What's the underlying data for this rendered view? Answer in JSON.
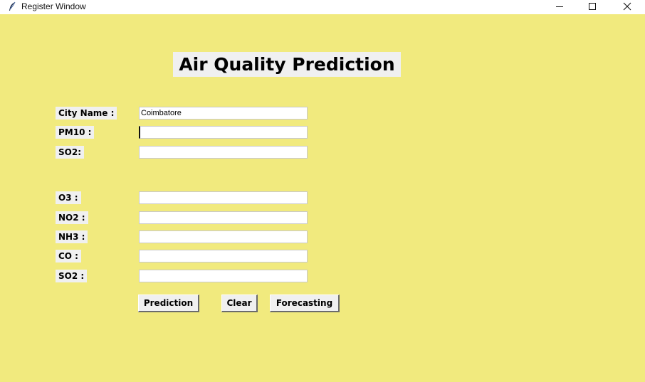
{
  "window": {
    "title": "Register Window",
    "icon": "feather-icon",
    "controls": [
      "minimize-icon",
      "maximize-icon",
      "close-icon"
    ]
  },
  "heading": "Air Quality Prediction",
  "form": {
    "fields": [
      {
        "label": "City Name :",
        "value": "Coimbatore"
      },
      {
        "label": "PM10 :",
        "value": ""
      },
      {
        "label": "SO2:",
        "value": ""
      },
      {
        "label": "O3 :",
        "value": ""
      },
      {
        "label": "NO2 :",
        "value": ""
      },
      {
        "label": "NH3 :",
        "value": ""
      },
      {
        "label": "CO :",
        "value": ""
      },
      {
        "label": "SO2 :",
        "value": ""
      }
    ]
  },
  "buttons": {
    "prediction": "Prediction",
    "clear": "Clear",
    "forecasting": "Forecasting"
  },
  "colors": {
    "background": "#f1ea7e",
    "label_background": "#f0f0f0",
    "input_background": "#ffffff"
  }
}
